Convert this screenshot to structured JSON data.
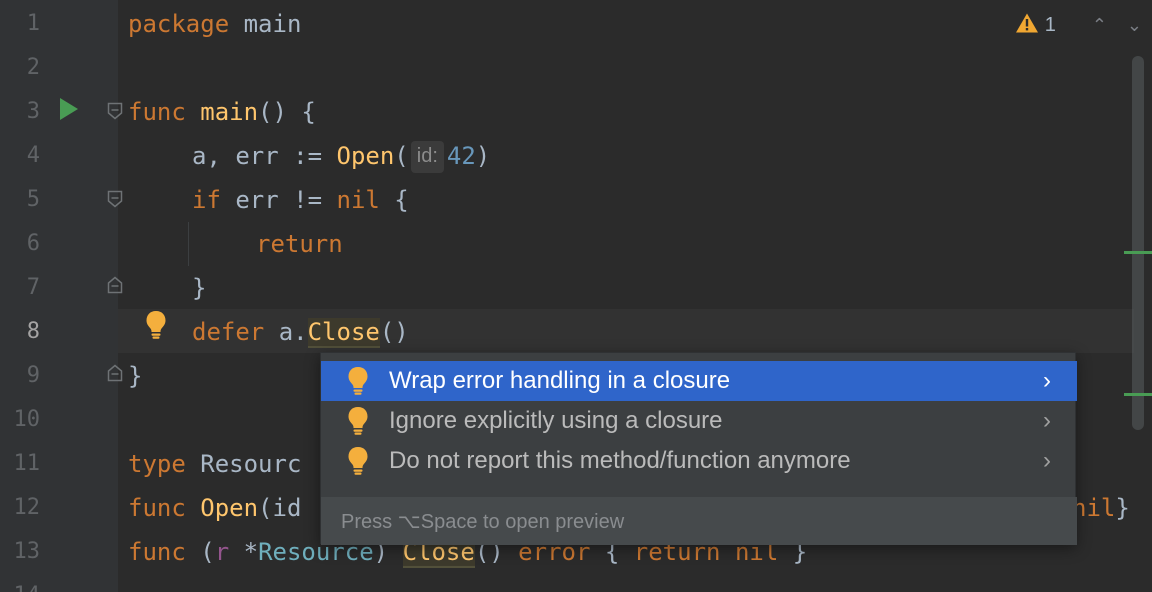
{
  "editor": {
    "line_numbers": [
      "1",
      "2",
      "3",
      "4",
      "5",
      "6",
      "7",
      "8",
      "9",
      "10",
      "11",
      "12",
      "13",
      "14"
    ],
    "active_line": "8",
    "lines": {
      "l1": {
        "kw": "package",
        "name": "main"
      },
      "l3": {
        "kw": "func",
        "fn": "main",
        "rest": "() {"
      },
      "l4": {
        "pre": "a, err := ",
        "fn": "Open",
        "open": "(",
        "hint": "id:",
        "num": "42",
        "close": ")"
      },
      "l5": {
        "kw": "if",
        "mid": " err != ",
        "kw2": "nil",
        "rest": " {"
      },
      "l6": {
        "kw": "return"
      },
      "l7": {
        "text": "}"
      },
      "l8": {
        "kw": "defer",
        "pre": " a.",
        "fn": "Close",
        "rest": "()"
      },
      "l9": {
        "text": "}"
      },
      "l11": {
        "kw": "type",
        "rest": " Resourc"
      },
      "l12": {
        "kw": "func",
        "fn": "Open",
        "rest": "(id",
        "tail_kw": "nil",
        "tail": "}"
      },
      "l13": {
        "kw": "func",
        "p1": " (",
        "r": "r",
        "star": " *",
        "type": "Resource",
        "p2": ") ",
        "fn": "Close",
        "p3": "() ",
        "kw_err": "error",
        "p4": " { ",
        "kw_ret": "return",
        "p5": " ",
        "kw_nil": "nil",
        "p6": " }"
      }
    }
  },
  "status": {
    "warning_count": "1",
    "warning_icon": "warning-triangle-icon",
    "prev_icon": "chevron-up-icon",
    "next_icon": "chevron-down-icon",
    "up_glyph": "⌃",
    "down_glyph": "⌄"
  },
  "popup": {
    "items": [
      {
        "label": "Wrap error handling in a closure",
        "selected": true
      },
      {
        "label": "Ignore explicitly using a closure",
        "selected": false
      },
      {
        "label": "Do not report this method/function anymore",
        "selected": false
      }
    ],
    "arrow": "›",
    "footer": "Press ⌥Space to open preview"
  },
  "colors": {
    "background": "#2b2b2b",
    "keyword": "#cc7832",
    "function": "#ffc66d",
    "number": "#6897bb",
    "selection": "#2f65ca",
    "run": "#499c54",
    "bulb": "#f4af3d"
  }
}
